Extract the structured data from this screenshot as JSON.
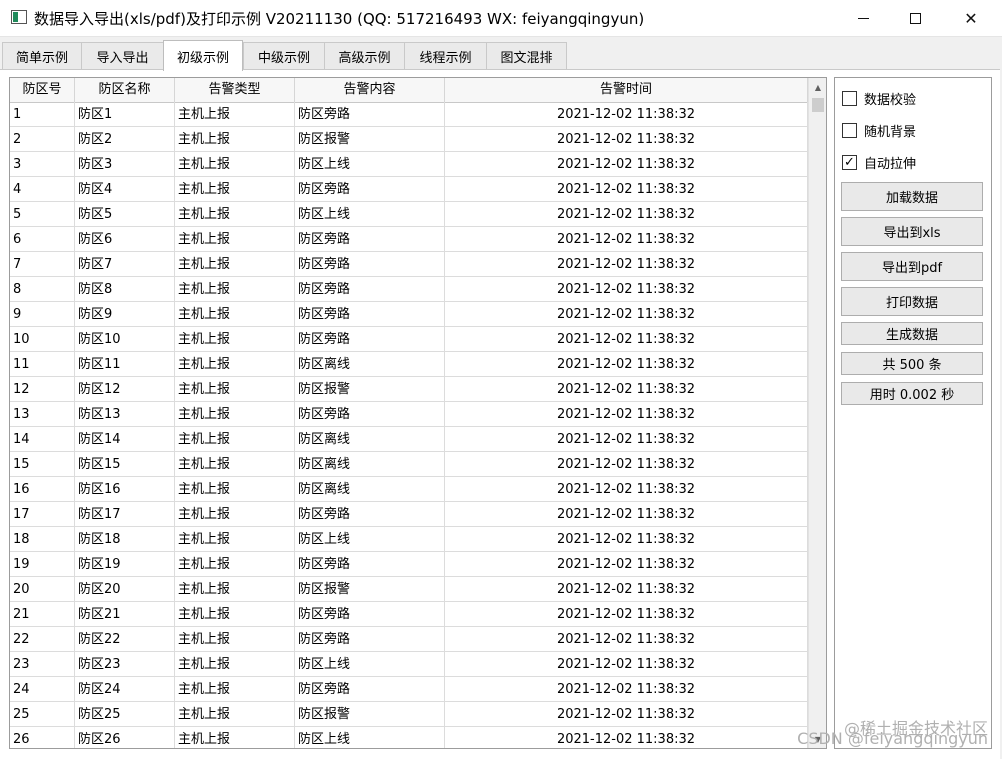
{
  "window": {
    "title": "数据导入导出(xls/pdf)及打印示例 V20211130 (QQ: 517216493 WX: feiyangqingyun)",
    "minimize_icon": "minimize-icon",
    "maximize_icon": "maximize-icon",
    "close_glyph": "✕"
  },
  "tabs": [
    {
      "label": "简单示例"
    },
    {
      "label": "导入导出"
    },
    {
      "label": "初级示例",
      "active": true
    },
    {
      "label": "中级示例"
    },
    {
      "label": "高级示例"
    },
    {
      "label": "线程示例"
    },
    {
      "label": "图文混排"
    }
  ],
  "table": {
    "headers": [
      "防区号",
      "防区名称",
      "告警类型",
      "告警内容",
      "告警时间"
    ],
    "rows": [
      [
        "1",
        "防区1",
        "主机上报",
        "防区旁路",
        "2021-12-02 11:38:32"
      ],
      [
        "2",
        "防区2",
        "主机上报",
        "防区报警",
        "2021-12-02 11:38:32"
      ],
      [
        "3",
        "防区3",
        "主机上报",
        "防区上线",
        "2021-12-02 11:38:32"
      ],
      [
        "4",
        "防区4",
        "主机上报",
        "防区旁路",
        "2021-12-02 11:38:32"
      ],
      [
        "5",
        "防区5",
        "主机上报",
        "防区上线",
        "2021-12-02 11:38:32"
      ],
      [
        "6",
        "防区6",
        "主机上报",
        "防区旁路",
        "2021-12-02 11:38:32"
      ],
      [
        "7",
        "防区7",
        "主机上报",
        "防区旁路",
        "2021-12-02 11:38:32"
      ],
      [
        "8",
        "防区8",
        "主机上报",
        "防区旁路",
        "2021-12-02 11:38:32"
      ],
      [
        "9",
        "防区9",
        "主机上报",
        "防区旁路",
        "2021-12-02 11:38:32"
      ],
      [
        "10",
        "防区10",
        "主机上报",
        "防区旁路",
        "2021-12-02 11:38:32"
      ],
      [
        "11",
        "防区11",
        "主机上报",
        "防区离线",
        "2021-12-02 11:38:32"
      ],
      [
        "12",
        "防区12",
        "主机上报",
        "防区报警",
        "2021-12-02 11:38:32"
      ],
      [
        "13",
        "防区13",
        "主机上报",
        "防区旁路",
        "2021-12-02 11:38:32"
      ],
      [
        "14",
        "防区14",
        "主机上报",
        "防区离线",
        "2021-12-02 11:38:32"
      ],
      [
        "15",
        "防区15",
        "主机上报",
        "防区离线",
        "2021-12-02 11:38:32"
      ],
      [
        "16",
        "防区16",
        "主机上报",
        "防区离线",
        "2021-12-02 11:38:32"
      ],
      [
        "17",
        "防区17",
        "主机上报",
        "防区旁路",
        "2021-12-02 11:38:32"
      ],
      [
        "18",
        "防区18",
        "主机上报",
        "防区上线",
        "2021-12-02 11:38:32"
      ],
      [
        "19",
        "防区19",
        "主机上报",
        "防区旁路",
        "2021-12-02 11:38:32"
      ],
      [
        "20",
        "防区20",
        "主机上报",
        "防区报警",
        "2021-12-02 11:38:32"
      ],
      [
        "21",
        "防区21",
        "主机上报",
        "防区旁路",
        "2021-12-02 11:38:32"
      ],
      [
        "22",
        "防区22",
        "主机上报",
        "防区旁路",
        "2021-12-02 11:38:32"
      ],
      [
        "23",
        "防区23",
        "主机上报",
        "防区上线",
        "2021-12-02 11:38:32"
      ],
      [
        "24",
        "防区24",
        "主机上报",
        "防区旁路",
        "2021-12-02 11:38:32"
      ],
      [
        "25",
        "防区25",
        "主机上报",
        "防区报警",
        "2021-12-02 11:38:32"
      ],
      [
        "26",
        "防区26",
        "主机上报",
        "防区上线",
        "2021-12-02 11:38:32"
      ]
    ]
  },
  "side_panel": {
    "checkboxes": [
      {
        "label": "数据校验",
        "checked": false
      },
      {
        "label": "随机背景",
        "checked": false
      },
      {
        "label": "自动拉伸",
        "checked": true
      }
    ],
    "check_glyph": "✓",
    "buttons": [
      {
        "label": "加载数据"
      },
      {
        "label": "导出到xls"
      },
      {
        "label": "导出到pdf"
      },
      {
        "label": "打印数据"
      },
      {
        "label": "生成数据"
      },
      {
        "label": "共 500 条"
      },
      {
        "label": "用时 0.002 秒"
      }
    ]
  },
  "watermark": {
    "line1": "@稀土掘金技术社区",
    "line2": "CSDN @feiyangqingyun"
  }
}
